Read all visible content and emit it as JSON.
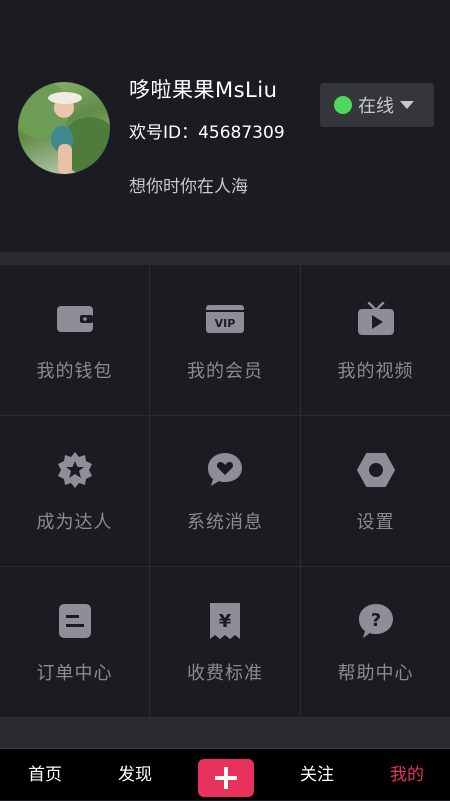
{
  "profile": {
    "name": "哆啦果果MsLiu",
    "id": "欢号ID：45687309",
    "signature": "想你时你在人海",
    "status": {
      "label": "在线",
      "dot_color": "#4fd65c"
    }
  },
  "grid": [
    {
      "label": "我的钱包",
      "icon": "wallet-icon"
    },
    {
      "label": "我的会员",
      "icon": "vip-card-icon",
      "icon_text": "VIP"
    },
    {
      "label": "我的视频",
      "icon": "tv-play-icon"
    },
    {
      "label": "成为达人",
      "icon": "star-badge-icon"
    },
    {
      "label": "系统消息",
      "icon": "heart-chat-icon"
    },
    {
      "label": "设置",
      "icon": "hexagon-settings-icon"
    },
    {
      "label": "订单中心",
      "icon": "order-doc-icon"
    },
    {
      "label": "收费标准",
      "icon": "yen-receipt-icon",
      "icon_text": "¥"
    },
    {
      "label": "帮助中心",
      "icon": "question-chat-icon",
      "icon_text": "?"
    }
  ],
  "tabbar": {
    "items": [
      {
        "label": "首页"
      },
      {
        "label": "发现"
      },
      {
        "label": "关注"
      },
      {
        "label": "我的",
        "active": true
      }
    ],
    "accent": "#e8315b"
  }
}
